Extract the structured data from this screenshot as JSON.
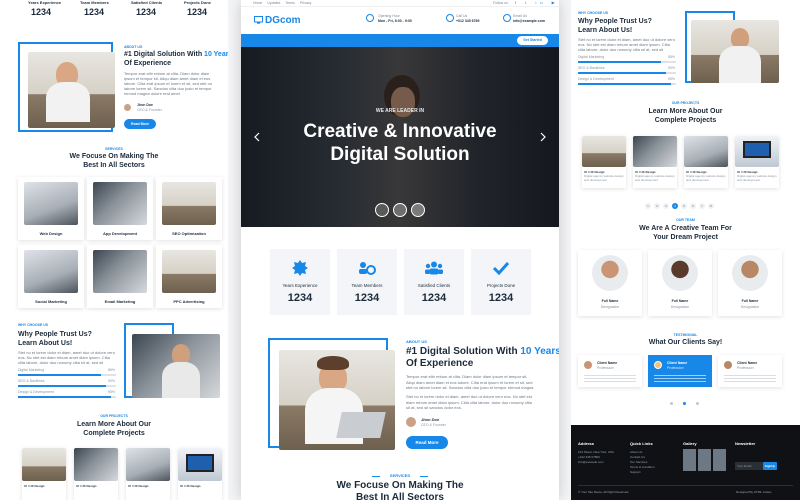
{
  "brand": "DGcom",
  "topbar": {
    "links": [
      "Home",
      "Updates",
      "Terms",
      "Privacy"
    ],
    "follow": "Follow us"
  },
  "contact": {
    "opening_label": "Opening Hour",
    "opening_value": "Mon - Fri, 8:00 - 9:00",
    "call_label": "Call Us",
    "call_value": "+012 345 6789",
    "email_label": "Email Us",
    "email_value": "info@example.com"
  },
  "nav": {
    "items": [
      "Home",
      "About Us",
      "Services",
      "Projects",
      "Pages",
      "Contact Us"
    ],
    "cta": "Get Started"
  },
  "hero": {
    "kicker": "WE ARE LEADER IN",
    "title_line1": "Creative & Innovative",
    "title_line2": "Digital Solution"
  },
  "stats": [
    {
      "label": "Years Experience",
      "value": "1234"
    },
    {
      "label": "Team Members",
      "value": "1234"
    },
    {
      "label": "Satisfied Clients",
      "value": "1234"
    },
    {
      "label": "Projects Done",
      "value": "1234"
    }
  ],
  "left_stats": [
    {
      "label": "Years Experience",
      "value": "1234"
    },
    {
      "label": "Team Members",
      "value": "1234"
    },
    {
      "label": "Satisfied Clients",
      "value": "1234"
    },
    {
      "label": "Projects Done",
      "value": "1234"
    }
  ],
  "about": {
    "kicker": "ABOUT US",
    "title_part1": "#1 Digital Solution With ",
    "title_highlight": "10 Years",
    "title_part2": " Of Experience",
    "body1": "Tempor erat elitr rebum at clita. Diam dolor diam ipsum et tempor sit. Aliqu diam amet diam et eos labore. Clita erat ipsum et lorem et sit, sed stet no labore lorem sit. Sanctus clita duo justo et tempor eirmod magna dolore erat amet",
    "body2": "Stet no et lorem dolor et diam, amet duo ut dolore vero eos. No stet est diam rebum amet diam ipsum. Clita clita labore, dolor duo nonumy clita sit at, sed sit sanctus dolor eos.",
    "signer": "Jhon Doe",
    "signer_role": "CEO & Founder",
    "button": "Read More"
  },
  "services": {
    "kicker": "SERVICES",
    "title_line1": "We Focuse On Making The",
    "title_line2": "Best In All Sectors",
    "items": [
      "Web Design",
      "App Development",
      "SEO Optimization",
      "Social Marketing",
      "Email Marketing",
      "PPC Advertising"
    ]
  },
  "why": {
    "kicker": "WHY CHOOSE US",
    "title_line1": "Why People Trust Us?",
    "title_line2": "Learn About Us!",
    "skills": [
      {
        "name": "Digital Marketing",
        "pct": "85%",
        "level": 0.85
      },
      {
        "name": "SEO & Backlinks",
        "pct": "90%",
        "level": 0.9
      },
      {
        "name": "Design & Development",
        "pct": "95%",
        "level": 0.95
      }
    ]
  },
  "projects": {
    "kicker": "OUR PROJECTS",
    "title_line1": "Learn More About Our",
    "title_line2": "Complete Projects",
    "item_title": "UI / UX Design",
    "item_text": "Digital agency website design and development",
    "pages": [
      "1",
      "2",
      "3",
      "4",
      "5",
      "6",
      "7",
      "8"
    ]
  },
  "team": {
    "kicker": "OUR TEAM",
    "title_line1": "We Are A Creative Team For",
    "title_line2": "Your Dream Project",
    "members": [
      {
        "name": "Full Name",
        "role": "Designation"
      },
      {
        "name": "Full Name",
        "role": "Designation"
      },
      {
        "name": "Full Name",
        "role": "Designation"
      }
    ]
  },
  "testimonial": {
    "kicker": "TESTIMONIAL",
    "title": "What Our Clients Say!",
    "clients": [
      {
        "name": "Client Name",
        "role": "Profession"
      },
      {
        "name": "Client Name",
        "role": "Profession"
      },
      {
        "name": "Client Name",
        "role": "Profession"
      }
    ]
  },
  "footer": {
    "cols": [
      "Address",
      "Quick Links",
      "Gallery",
      "Newsletter"
    ],
    "address": [
      "123 Street, New York, USA",
      "+012 345 67890",
      "info@example.com"
    ],
    "links": [
      "About Us",
      "Contact Us",
      "Our Services",
      "Terms & Condition",
      "Support"
    ],
    "newsletter_placeholder": "Your Email",
    "newsletter_button": "SignUp",
    "copyright": "© Your Site Name, All Right Reserved.",
    "credit": "Designed By HTML Codex"
  },
  "colors": {
    "accent": "#1787e8",
    "dark": "#1c2a3a",
    "footer": "#0f1115"
  }
}
